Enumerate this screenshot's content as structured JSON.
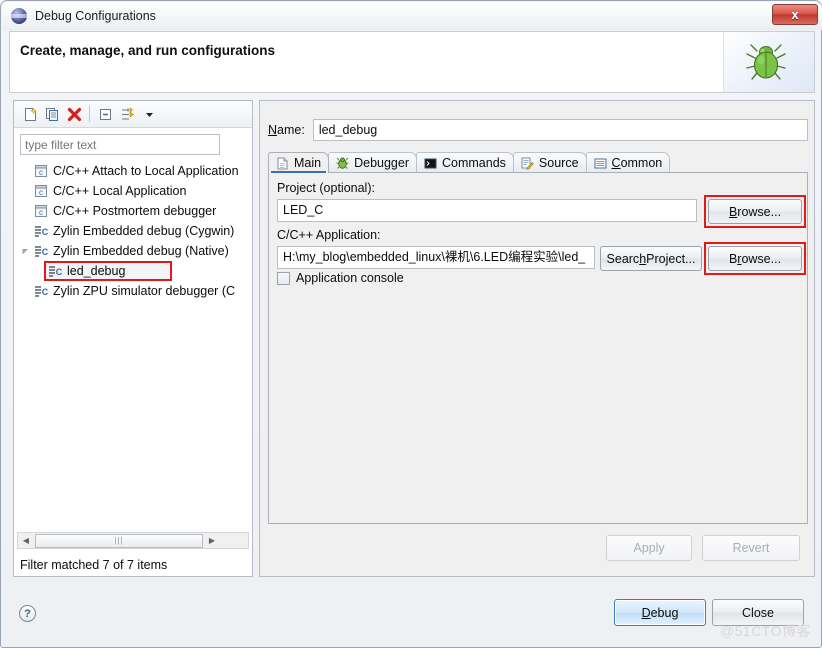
{
  "window": {
    "title": "Debug Configurations",
    "icon": "eclipse-debug-icon",
    "close_label": "x"
  },
  "header": {
    "title": "Create, manage, and run configurations",
    "banner_icon": "green-bug-icon"
  },
  "tree_toolbar": {
    "buttons": [
      {
        "name": "new-configuration-button",
        "icon": "new-document-icon"
      },
      {
        "name": "duplicate-configuration-button",
        "icon": "copy-icon"
      },
      {
        "name": "delete-configuration-button",
        "icon": "red-x-delete-icon"
      },
      {
        "name": "collapse-all-button",
        "icon": "collapse-all-icon"
      },
      {
        "name": "filter-configurations-button",
        "icon": "filter-arrows-icon"
      },
      {
        "name": "view-menu-button",
        "icon": "chevron-down-icon"
      }
    ]
  },
  "filter": {
    "placeholder": "type filter text",
    "value": "",
    "status": "Filter matched 7 of 7 items"
  },
  "tree": {
    "items": [
      {
        "label": "C/C++ Attach to Local Application",
        "icon": "c-file-icon",
        "indent": 1,
        "expandable": false,
        "selected": false
      },
      {
        "label": "C/C++ Local Application",
        "icon": "c-file-icon",
        "indent": 1,
        "expandable": false,
        "selected": false
      },
      {
        "label": "C/C++ Postmortem debugger",
        "icon": "c-file-icon",
        "indent": 1,
        "expandable": false,
        "selected": false
      },
      {
        "label": "Zylin Embedded debug (Cygwin)",
        "icon": "zylin-debug-icon",
        "indent": 1,
        "expandable": false,
        "selected": false
      },
      {
        "label": "Zylin Embedded debug (Native)",
        "icon": "zylin-debug-icon",
        "indent": 1,
        "expandable": true,
        "selected": false
      },
      {
        "label": "led_debug",
        "icon": "zylin-debug-icon",
        "indent": 2,
        "expandable": false,
        "selected": true
      },
      {
        "label": "Zylin ZPU simulator debugger (C",
        "icon": "zylin-debug-icon",
        "indent": 1,
        "expandable": false,
        "selected": false
      }
    ]
  },
  "name_field": {
    "label": "Name:",
    "label_mnemonic": "N",
    "value": "led_debug"
  },
  "tabs": [
    {
      "label": "Main",
      "icon": "main-document-icon",
      "active": true
    },
    {
      "label": "Debugger",
      "icon": "debugger-bug-icon",
      "active": false
    },
    {
      "label": "Commands",
      "icon": "commands-terminal-icon",
      "active": false
    },
    {
      "label": "Source",
      "icon": "source-pencil-icon",
      "active": false
    },
    {
      "label": "Common",
      "icon": "common-list-icon",
      "active": false,
      "mnemonic": "C"
    }
  ],
  "main_tab": {
    "project_label": "Project (optional):",
    "project_value": "LED_C",
    "project_browse_label": "Browse...",
    "project_browse_mnemonic": "B",
    "application_label": "C/C++ Application:",
    "application_value": "H:\\my_blog\\embedded_linux\\裸机\\6.LED编程实验\\led_",
    "search_project_label": "Search Project...",
    "search_project_mnemonic": "h",
    "application_browse_label": "Browse...",
    "application_browse_mnemonic": "r",
    "console_checkbox_label": "Application console",
    "console_checkbox_checked": false
  },
  "panel_buttons": {
    "apply_label": "Apply",
    "apply_enabled": false,
    "revert_label": "Revert",
    "revert_enabled": false
  },
  "footer": {
    "help_label": "?",
    "debug_label": "Debug",
    "debug_mnemonic": "D",
    "close_label": "Close",
    "watermark": "@51CTO博客"
  },
  "colors": {
    "accent_blue": "#3a6fb5",
    "annotation_red": "#e01b16",
    "panel_bg": "#f0f0f0",
    "close_red": "#c23a2e"
  }
}
